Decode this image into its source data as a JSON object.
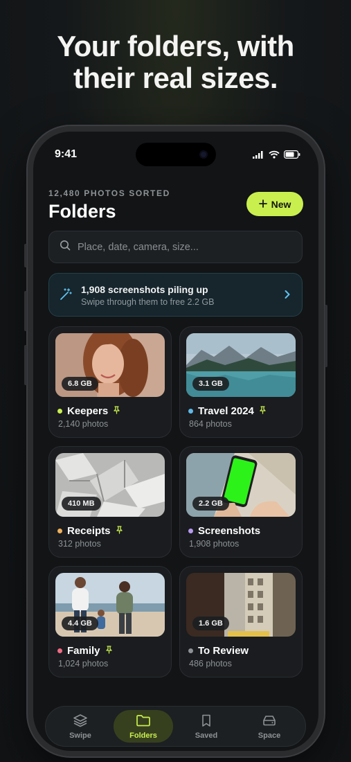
{
  "headline": [
    "Your folders, with",
    "their real sizes."
  ],
  "status": {
    "time": "9:41"
  },
  "header": {
    "eyebrow": "12,480 PHOTOS SORTED",
    "title": "Folders",
    "new_label": "New"
  },
  "search": {
    "placeholder": "Place, date, camera, size..."
  },
  "banner": {
    "title": "1,908 screenshots piling up",
    "subtitle": "Swipe through them to free 2.2 GB"
  },
  "folders": [
    {
      "name": "Keepers",
      "count": "2,140 photos",
      "size": "6.8 GB",
      "dot": "#c9ef4f",
      "pinned": true
    },
    {
      "name": "Travel 2024",
      "count": "864 photos",
      "size": "3.1 GB",
      "dot": "#5fb8e6",
      "pinned": true
    },
    {
      "name": "Receipts",
      "count": "312 photos",
      "size": "410 MB",
      "dot": "#f0b05a",
      "pinned": true
    },
    {
      "name": "Screenshots",
      "count": "1,908 photos",
      "size": "2.2 GB",
      "dot": "#b79af0",
      "pinned": false
    },
    {
      "name": "Family",
      "count": "1,024 photos",
      "size": "4.4 GB",
      "dot": "#f26b83",
      "pinned": true
    },
    {
      "name": "To Review",
      "count": "486 photos",
      "size": "1.6 GB",
      "dot": "#8e9296",
      "pinned": false
    }
  ],
  "tabs": [
    {
      "label": "Swipe",
      "icon": "layers-icon",
      "active": false
    },
    {
      "label": "Folders",
      "icon": "folder-icon",
      "active": true
    },
    {
      "label": "Saved",
      "icon": "bookmark-icon",
      "active": false
    },
    {
      "label": "Space",
      "icon": "drive-icon",
      "active": false
    }
  ],
  "colors": {
    "accent": "#c9ef4f",
    "background": "#121416",
    "card": "#1a1c1f"
  }
}
